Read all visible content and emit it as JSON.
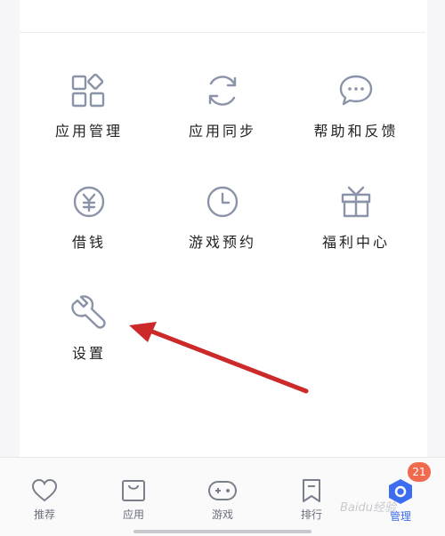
{
  "grid": {
    "tiles": [
      {
        "id": "app-management",
        "label": "应用管理",
        "icon": "apps-grid-icon"
      },
      {
        "id": "app-sync",
        "label": "应用同步",
        "icon": "sync-icon"
      },
      {
        "id": "help-feedback",
        "label": "帮助和反馈",
        "icon": "chat-bubble-icon"
      },
      {
        "id": "borrow",
        "label": "借钱",
        "icon": "yen-coin-icon"
      },
      {
        "id": "game-reservation",
        "label": "游戏预约",
        "icon": "clock-icon"
      },
      {
        "id": "welfare-center",
        "label": "福利中心",
        "icon": "gift-icon"
      },
      {
        "id": "settings",
        "label": "设置",
        "icon": "wrench-icon"
      }
    ]
  },
  "tabbar": {
    "items": [
      {
        "label": "推荐",
        "icon": "heart-icon"
      },
      {
        "label": "应用",
        "icon": "shopping-bag-icon"
      },
      {
        "label": "游戏",
        "icon": "gamepad-icon"
      },
      {
        "label": "排行",
        "icon": "bookmark-icon"
      },
      {
        "label": "管理",
        "icon": "manage-hex-icon",
        "active": true
      }
    ],
    "badge_count": "21"
  },
  "watermark": "Baidu经验",
  "colors": {
    "icon_stroke": "#8a93a8",
    "accent": "#3c6cf0",
    "badge": "#f06a4e",
    "arrow": "#cc2a2a"
  }
}
